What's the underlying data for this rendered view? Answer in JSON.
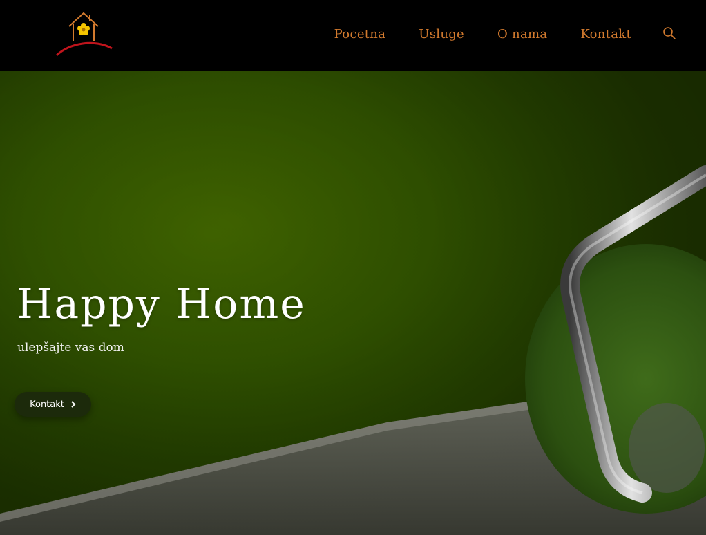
{
  "header": {
    "logo_icon": "house-with-flower-logo",
    "nav": [
      {
        "label": "Pocetna"
      },
      {
        "label": "Usluge"
      },
      {
        "label": "O nama"
      },
      {
        "label": "Kontakt"
      }
    ],
    "search_icon": "search-icon"
  },
  "hero": {
    "title": "Happy Home",
    "subtitle": "ulepšajte vas dom",
    "button_label": "Kontakt",
    "button_icon": "chevron-right-icon"
  },
  "colors": {
    "header_bg": "#000000",
    "nav_text": "#d27a2e",
    "hero_green": "#3a5c00",
    "button_bg": "#1c2a0b",
    "logo_red": "#c0141c",
    "logo_flower": "#f4c400"
  }
}
